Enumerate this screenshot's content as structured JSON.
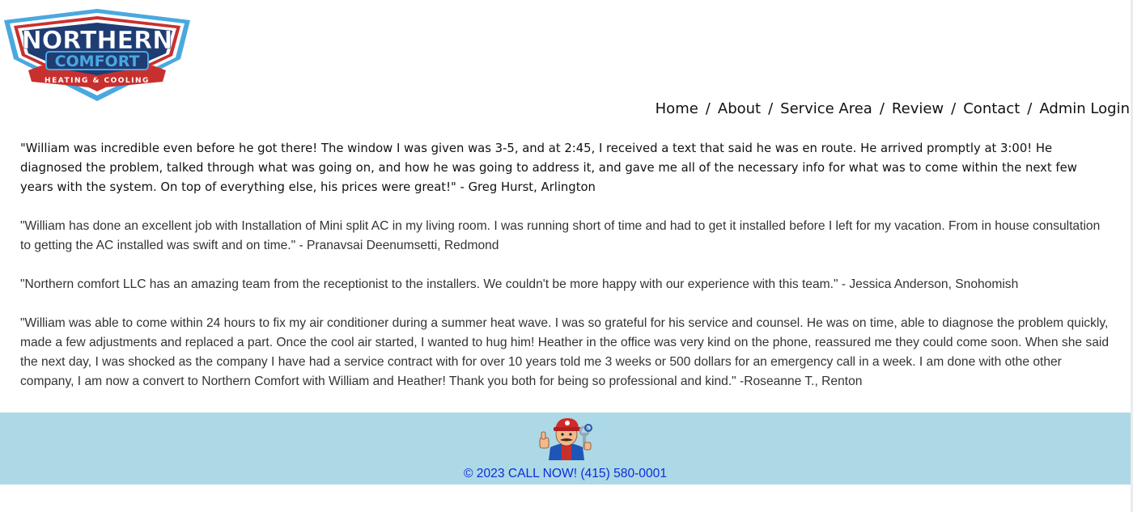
{
  "logo": {
    "line1": "NORTHERN",
    "line2": "COMFORT",
    "line3": "HEATING & COOLING",
    "colors": {
      "navy": "#1f3c73",
      "red": "#c8302e",
      "light_blue": "#4aa8e0"
    }
  },
  "nav": {
    "items": [
      "Home",
      "About",
      "Service Area",
      "Review",
      "Contact",
      "Admin Login"
    ],
    "separator": "/"
  },
  "reviews": [
    "\"William was incredible even before he got there! The window I was given was 3-5, and at 2:45, I received a text that said he was en route. He arrived promptly at 3:00! He diagnosed the problem, talked through what was going on, and how he was going to address it, and gave me all of the necessary info for what was to come within the next few years with the system. On top of everything else, his prices were great!\" - Greg Hurst, Arlington",
    "\"William has done an excellent job with Installation of Mini split AC in my living room. I was running short of time and had to get it installed before I left for my vacation. From in house consultation to getting the AC installed was swift and on time.\" - Pranavsai Deenumsetti, Redmond",
    "\"Northern comfort LLC has an amazing team from the receptionist to the installers. We couldn't be more happy with our experience with this team.\" - Jessica Anderson, Snohomish",
    "\"William was able to come within 24 hours to fix my air conditioner during a summer heat wave. I was so grateful for his service and counsel. He was on time, able to diagnose the problem quickly, made a few adjustments and replaced a part. Once the cool air started, I wanted to hug him! Heather in the office was very kind on the phone, reassured me they could come soon. When she said the next day, I was shocked as the company I have had a service contract with for over 10 years told me 3 weeks or 500 dollars for an emergency call in a week. I am done with othe other company, I am now a convert to Northern Comfort with William and Heather! Thank you both for being so professional and kind.\" -Roseanne T., Renton"
  ],
  "footer": {
    "text": "© 2023 CALL NOW! (415) 580-0001",
    "mascot_icon": "technician-mascot-icon",
    "colors": {
      "background": "#add8e6",
      "text": "#0b2cd9"
    }
  }
}
